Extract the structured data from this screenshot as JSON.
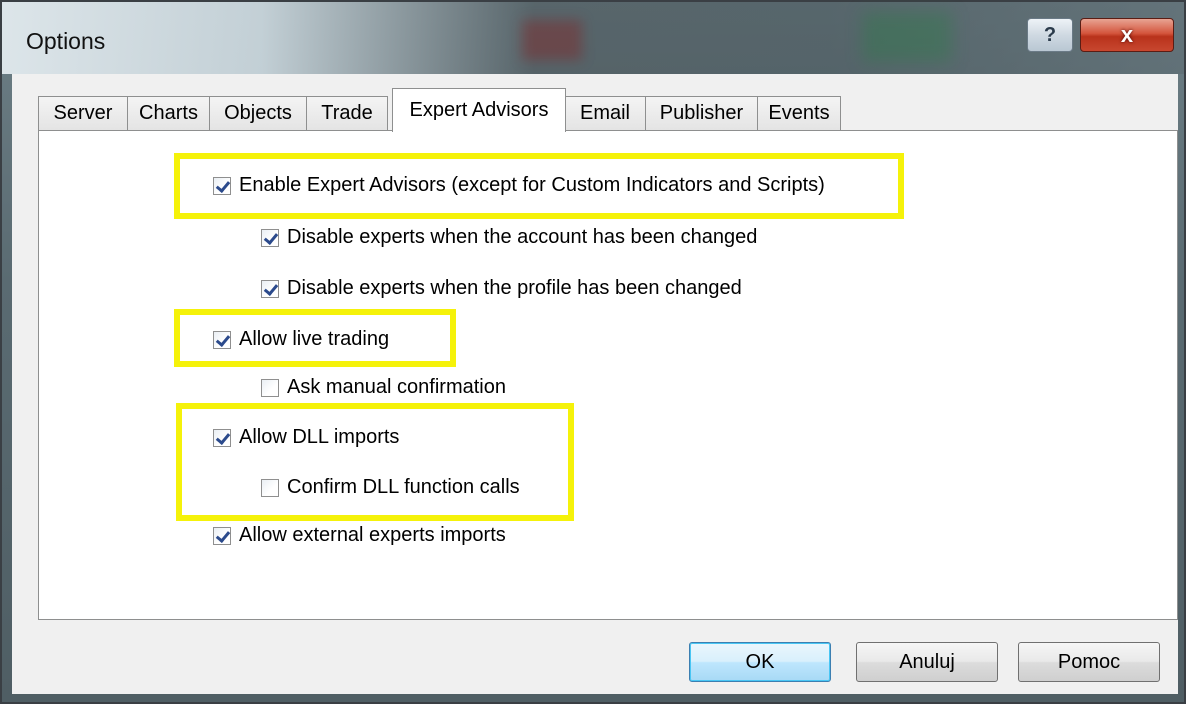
{
  "window": {
    "title": "Options",
    "help_glyph": "?",
    "close_glyph": "x"
  },
  "tabs": [
    {
      "label": "Server"
    },
    {
      "label": "Charts"
    },
    {
      "label": "Objects"
    },
    {
      "label": "Trade"
    },
    {
      "label": "Expert Advisors",
      "active": true
    },
    {
      "label": "Email"
    },
    {
      "label": "Publisher"
    },
    {
      "label": "Events"
    }
  ],
  "options": {
    "enable_experts": {
      "label": "Enable Expert Advisors (except for Custom Indicators and Scripts)",
      "checked": true
    },
    "disable_account_changed": {
      "label": "Disable experts when the account has been changed",
      "checked": true
    },
    "disable_profile_changed": {
      "label": "Disable experts when the profile has been changed",
      "checked": true
    },
    "allow_live_trading": {
      "label": "Allow live trading",
      "checked": true
    },
    "ask_manual_confirmation": {
      "label": "Ask manual confirmation",
      "checked": false
    },
    "allow_dll_imports": {
      "label": "Allow DLL imports",
      "checked": true
    },
    "confirm_dll_calls": {
      "label": "Confirm DLL function calls",
      "checked": false
    },
    "allow_external_imports": {
      "label": "Allow external experts imports",
      "checked": true
    }
  },
  "buttons": {
    "ok": "OK",
    "cancel": "Anuluj",
    "help": "Pomoc"
  },
  "colors": {
    "highlight": "#f5f20a",
    "checkmark": "#2b4a8c",
    "close_button": "#c8472f"
  }
}
